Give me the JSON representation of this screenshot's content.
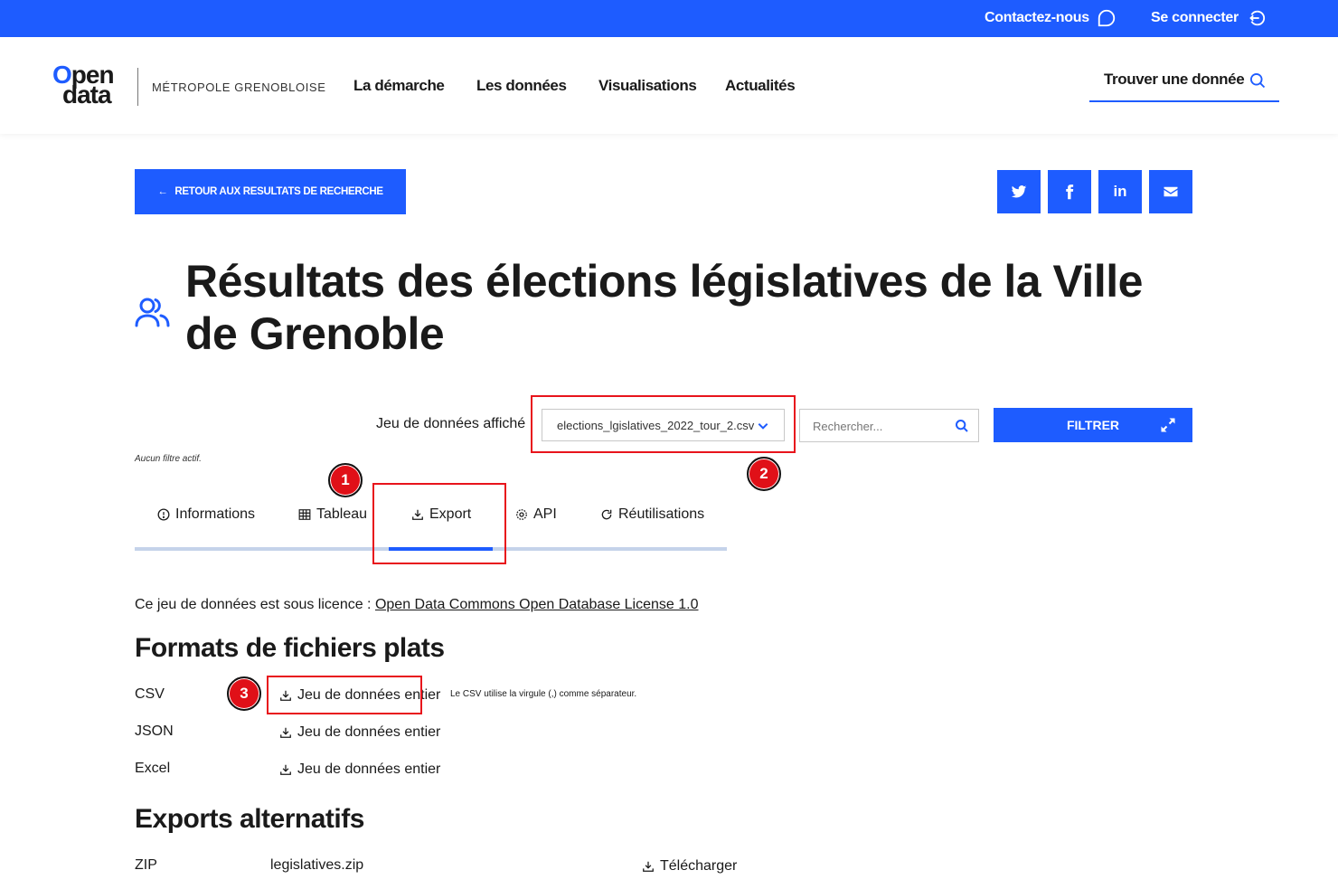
{
  "topbar": {
    "contact_label": "Contactez-nous",
    "login_label": "Se connecter"
  },
  "header": {
    "logo_line1": "pen",
    "logo_line1_o": "O",
    "logo_line2": "data",
    "metropole": "MÉTROPOLE GRENOBLOISE",
    "nav": [
      "La démarche",
      "Les données",
      "Visualisations",
      "Actualités"
    ],
    "find_label": "Trouver une donnée"
  },
  "actions": {
    "back_label": "RETOUR AUX RESULTATS DE RECHERCHE",
    "share": [
      "twitter-icon",
      "facebook-icon",
      "linkedin-icon",
      "mail-icon"
    ]
  },
  "page": {
    "title": "Résultats des élections législatives de la Ville de Grenoble",
    "title_icon": "users-icon"
  },
  "filters": {
    "dataset_label": "Jeu de données affiché",
    "dataset_selected": "elections_lgislatives_2022_tour_2.csv",
    "search_placeholder": "Rechercher...",
    "filter_button": "FILTRER",
    "no_filter": "Aucun filtre actif."
  },
  "tabs": [
    {
      "label": "Informations",
      "icon": "info-icon"
    },
    {
      "label": "Tableau",
      "icon": "table-icon"
    },
    {
      "label": "Export",
      "icon": "download-icon",
      "active": true
    },
    {
      "label": "API",
      "icon": "gear-icon"
    },
    {
      "label": "Réutilisations",
      "icon": "refresh-icon"
    }
  ],
  "annotations": [
    "1",
    "2",
    "3"
  ],
  "content": {
    "license_prefix": "Ce jeu de données est sous licence : ",
    "license_link": "Open Data Commons Open Database License 1.0",
    "flat_formats_title": "Formats de fichiers plats",
    "formats": [
      {
        "name": "CSV",
        "link": "Jeu de données entier",
        "note": "Le CSV utilise la virgule (,) comme séparateur."
      },
      {
        "name": "JSON",
        "link": "Jeu de données entier"
      },
      {
        "name": "Excel",
        "link": "Jeu de données entier"
      }
    ],
    "alt_exports_title": "Exports alternatifs",
    "alt_exports": [
      {
        "type": "ZIP",
        "file": "legislatives.zip",
        "action": "Télécharger"
      }
    ]
  },
  "colors": {
    "primary": "#1e5cff",
    "annotation": "#e8141c"
  }
}
